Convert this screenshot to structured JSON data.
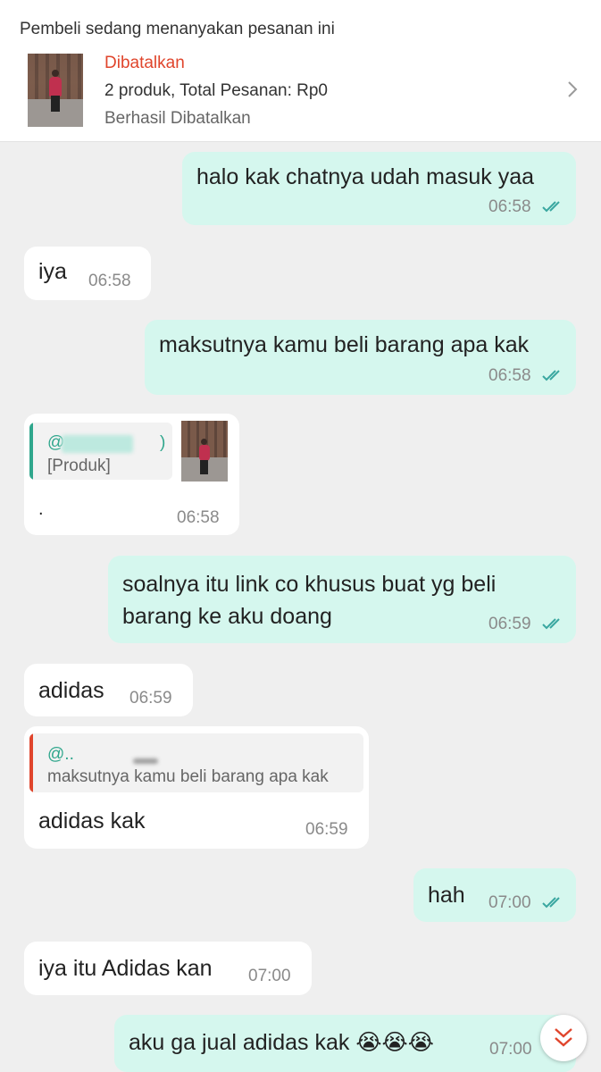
{
  "order": {
    "caption": "Pembeli sedang menanyakan pesanan ini",
    "status": "Dibatalkan",
    "summary": "2 produk, Total Pesanan: Rp0",
    "result": "Berhasil Dibatalkan",
    "thumbnail_icon": "product-photo",
    "chevron_icon": "chevron-right-icon",
    "status_color": "#e0452c"
  },
  "messages": [
    {
      "direction": "out",
      "text": "halo kak chatnya udah masuk yaa",
      "time": "06:58",
      "read": true
    },
    {
      "direction": "in",
      "text": "iya",
      "time": "06:58"
    },
    {
      "direction": "out",
      "text": "maksutnya kamu beli barang apa kak",
      "time": "06:58",
      "read": true
    },
    {
      "direction": "in",
      "type": "product_reply",
      "quote_handle": "@",
      "quote_handle_end": ")",
      "quote_text": "[Produk]",
      "text": ".",
      "time": "06:58"
    },
    {
      "direction": "out",
      "lines": [
        "soalnya itu link co khusus buat yg beli",
        "barang ke aku doang"
      ],
      "time": "06:59",
      "read": true
    },
    {
      "direction": "in",
      "text": "adidas",
      "time": "06:59"
    },
    {
      "direction": "in",
      "type": "quote_reply",
      "quote_handle": "@..",
      "quote_text": "maksutnya kamu beli barang apa kak",
      "text": "adidas kak",
      "time": "06:59"
    },
    {
      "direction": "out",
      "text": "hah",
      "time": "07:00",
      "read": true
    },
    {
      "direction": "in",
      "text": "iya itu Adidas kan",
      "time": "07:00"
    },
    {
      "direction": "out",
      "text": "aku ga jual adidas kak 😭😭😭",
      "time": "07:00"
    }
  ],
  "colors": {
    "outgoing_bubble": "#d5f7ee",
    "incoming_bubble": "#ffffff",
    "background": "#efefef",
    "read_tick": "#3aa7a0",
    "quote_bar_product": "#2fa68c",
    "quote_bar_reply": "#e0452c",
    "scroll_button_icon": "#e0452c"
  },
  "scroll_button": {
    "icon": "double-chevron-down-icon"
  }
}
